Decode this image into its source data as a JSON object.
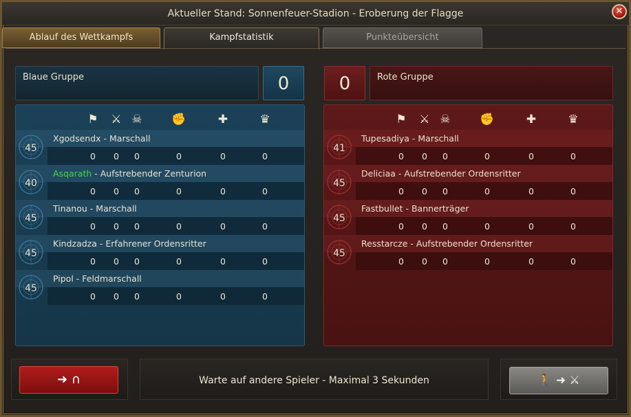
{
  "window": {
    "title": "Aktueller Stand: Sonnenfeuer-Stadion - Eroberung der Flagge"
  },
  "tabs": [
    {
      "label": "Ablauf des Wettkampfs"
    },
    {
      "label": "Kampfstatistik"
    },
    {
      "label": "Punkteübersicht"
    }
  ],
  "stat_icons": [
    "flag-icon",
    "crossed-swords-icon",
    "skull-icon",
    "fist-icon",
    "plus-icon",
    "crown-icon"
  ],
  "blue": {
    "name": "Blaue Gruppe",
    "score": "0",
    "color": "#1b4158",
    "players": [
      {
        "level": "45",
        "name": "Xgodsendx",
        "sep": " - ",
        "title": "Marschall",
        "stats": [
          "0",
          "0",
          "0",
          "0",
          "0",
          "0"
        ]
      },
      {
        "level": "40",
        "name": "Asqarath",
        "sep": " - ",
        "title": "Aufstrebender Zenturion",
        "stats": [
          "0",
          "0",
          "0",
          "0",
          "0",
          "0"
        ]
      },
      {
        "level": "45",
        "name": "Tinanou",
        "sep": " - ",
        "title": "Marschall",
        "stats": [
          "0",
          "0",
          "0",
          "0",
          "0",
          "0"
        ]
      },
      {
        "level": "45",
        "name": "Kindzadza",
        "sep": " - ",
        "title": "Erfahrener Ordensritter",
        "stats": [
          "0",
          "0",
          "0",
          "0",
          "0",
          "0"
        ]
      },
      {
        "level": "45",
        "name": "Pipol",
        "sep": " - ",
        "title": "Feldmarschall",
        "stats": [
          "0",
          "0",
          "0",
          "0",
          "0",
          "0"
        ]
      }
    ]
  },
  "red": {
    "name": "Rote Gruppe",
    "score": "0",
    "color": "#5e1818",
    "players": [
      {
        "level": "41",
        "name": "Tupesadiya",
        "sep": " - ",
        "title": "Marschall",
        "stats": [
          "0",
          "0",
          "0",
          "0",
          "0",
          "0"
        ]
      },
      {
        "level": "45",
        "name": "Deliciaa",
        "sep": " - ",
        "title": "Aufstrebender Ordensritter",
        "stats": [
          "0",
          "0",
          "0",
          "0",
          "0",
          "0"
        ]
      },
      {
        "level": "45",
        "name": "Fastbullet",
        "sep": " - ",
        "title": "Bannerträger",
        "stats": [
          "0",
          "0",
          "0",
          "0",
          "0",
          "0"
        ]
      },
      {
        "level": "45",
        "name": "Resstarcze",
        "sep": " - ",
        "title": "Aufstrebender Ordensritter",
        "stats": [
          "0",
          "0",
          "0",
          "0",
          "0",
          "0"
        ]
      }
    ]
  },
  "footer": {
    "status": "Warte auf andere Spieler - Maximal 3 Sekunden",
    "leave_icon": "exit-arena-icon",
    "join_icon": "enter-battle-icon"
  },
  "colors": {
    "highlight_name": "#3ddc3a",
    "leave_button": "#b21c1c",
    "join_button": "#8a8884"
  }
}
